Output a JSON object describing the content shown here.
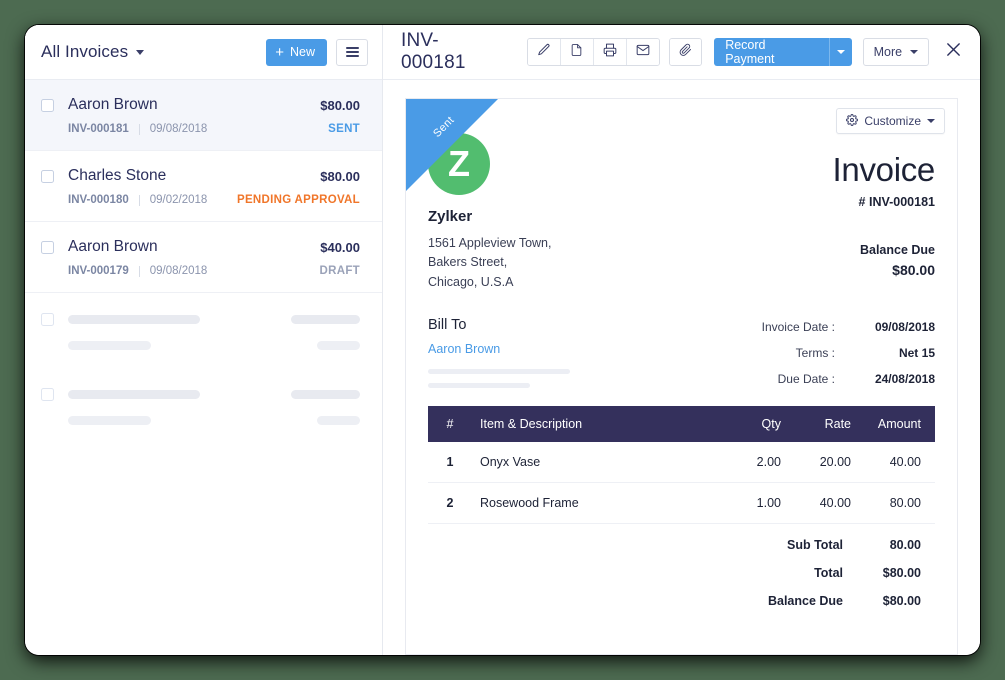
{
  "sidebar": {
    "title": "All Invoices",
    "new_button": "New",
    "plus": "+",
    "invoices": [
      {
        "name": "Aaron Brown",
        "amount": "$80.00",
        "number": "INV-000181",
        "date": "09/08/2018",
        "status": "SENT",
        "status_kind": "sent",
        "selected": true
      },
      {
        "name": "Charles Stone",
        "amount": "$80.00",
        "number": "INV-000180",
        "date": "09/02/2018",
        "status": "PENDING APPROVAL",
        "status_kind": "pending",
        "selected": false
      },
      {
        "name": "Aaron Brown",
        "amount": "$40.00",
        "number": "INV-000179",
        "date": "09/08/2018",
        "status": "DRAFT",
        "status_kind": "draft",
        "selected": false
      }
    ]
  },
  "detail": {
    "title": "INV-000181",
    "toolbar_icons": [
      "pencil-icon",
      "pdf-icon",
      "printer-icon",
      "envelope-icon"
    ],
    "attachment_icon": "paperclip-icon",
    "record_payment": "Record Payment",
    "more": "More",
    "close_icon": "close-icon"
  },
  "document": {
    "customize": "Customize",
    "customize_icon": "gear-icon",
    "ribbon": "Sent",
    "logo_letter": "Z",
    "company": {
      "name": "Zylker",
      "address_line1": "1561 Appleview Town,",
      "address_line2": "Bakers Street,",
      "address_line3": "Chicago, U.S.A"
    },
    "heading": "Invoice",
    "number": "# INV-000181",
    "balance_due_label": "Balance Due",
    "balance_due_value": "$80.00",
    "bill_to_label": "Bill To",
    "bill_to_name": "Aaron Brown",
    "dates": [
      {
        "label": "Invoice Date :",
        "value": "09/08/2018"
      },
      {
        "label": "Terms :",
        "value": "Net 15"
      },
      {
        "label": "Due Date :",
        "value": "24/08/2018"
      }
    ],
    "table": {
      "headers": {
        "num": "#",
        "desc": "Item & Description",
        "qty": "Qty",
        "rate": "Rate",
        "amount": "Amount"
      },
      "rows": [
        {
          "num": "1",
          "desc": "Onyx Vase",
          "qty": "2.00",
          "rate": "20.00",
          "amount": "40.00"
        },
        {
          "num": "2",
          "desc": "Rosewood Frame",
          "qty": "1.00",
          "rate": "40.00",
          "amount": "80.00"
        }
      ]
    },
    "totals": [
      {
        "label": "Sub Total",
        "value": "80.00"
      },
      {
        "label": "Total",
        "value": "$80.00"
      },
      {
        "label": "Balance Due",
        "value": "$80.00"
      }
    ]
  },
  "colors": {
    "accent_blue": "#4a9be6",
    "logo_green": "#52bd6f",
    "table_header": "#34305c",
    "status_pending": "#f0762a",
    "status_draft": "#9aa2b8",
    "page_background": "#4d6b51"
  }
}
